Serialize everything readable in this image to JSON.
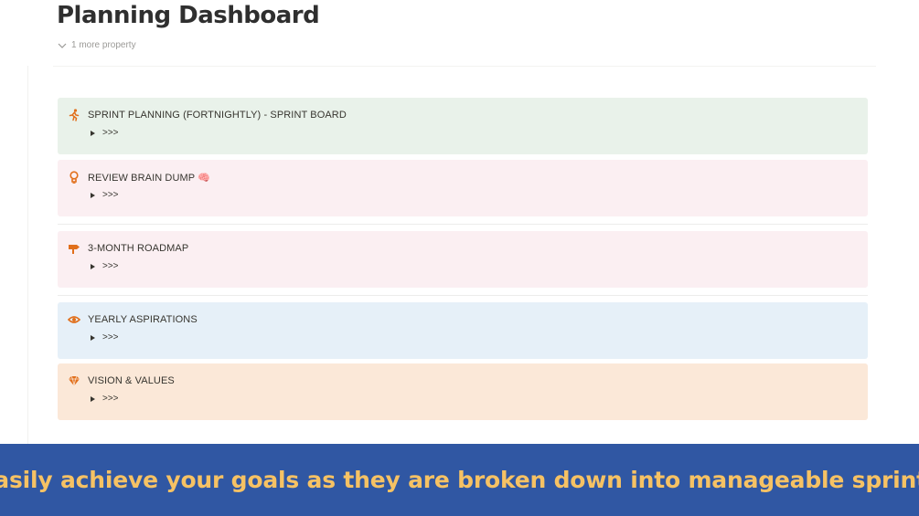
{
  "page": {
    "title": "Planning Dashboard",
    "property_toggle": "1 more property"
  },
  "callouts": [
    {
      "title": "SPRINT PLANNING (FORTNIGHTLY) - SPRINT BOARD",
      "toggle": ">>>",
      "icon": "running-person-icon",
      "bg": "#e9f2ea"
    },
    {
      "title": "REVIEW BRAIN DUMP 🧠",
      "toggle": ">>>",
      "icon": "lightbulb-icon",
      "bg": "#fbeff2"
    },
    {
      "title": "3-MONTH ROADMAP",
      "toggle": ">>>",
      "icon": "signpost-icon",
      "bg": "#fbeff2"
    },
    {
      "title": "YEARLY ASPIRATIONS",
      "toggle": ">>>",
      "icon": "eye-icon",
      "bg": "#e6f0f8"
    },
    {
      "title": "VISION & VALUES",
      "toggle": ">>>",
      "icon": "gem-icon",
      "bg": "#fbe8d8"
    }
  ],
  "colors": {
    "icon_accent": "#e16f1b",
    "banner_bg": "#3057a3",
    "banner_text": "#f6c264"
  },
  "banner": {
    "text": "Easily achieve your goals as they are broken down into manageable sprints"
  }
}
